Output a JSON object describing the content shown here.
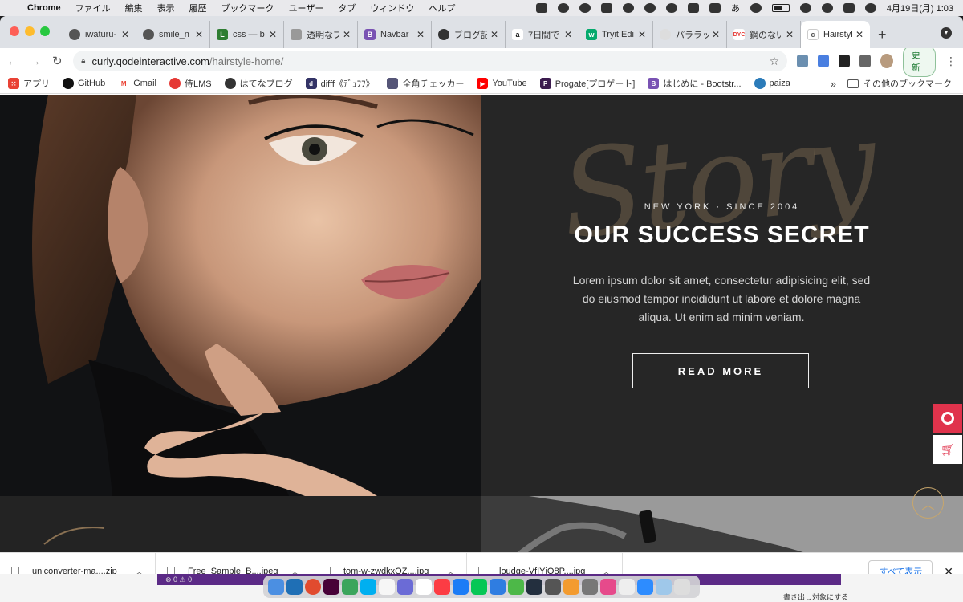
{
  "menubar": {
    "app": "Chrome",
    "items": [
      "ファイル",
      "編集",
      "表示",
      "履歴",
      "ブックマーク",
      "ユーザー",
      "タブ",
      "ウィンドウ",
      "ヘルプ"
    ],
    "datetime": "4月19日(月)  1:03",
    "input_method": "あ"
  },
  "tabs": [
    {
      "title": "iwaturu-",
      "color": "#555"
    },
    {
      "title": "smile_n",
      "color": "#555"
    },
    {
      "title": "css — b",
      "color": "#2e7d32"
    },
    {
      "title": "透明なブ",
      "color": "#999"
    },
    {
      "title": "Navbar",
      "color": "#7952b3"
    },
    {
      "title": "ブログ記",
      "color": "#333"
    },
    {
      "title": "7日間で",
      "color": "#222"
    },
    {
      "title": "Tryit Edi",
      "color": "#04aa6d"
    },
    {
      "title": "パララッ",
      "color": "#bbb"
    },
    {
      "title": "鋼のない",
      "color": "#e53935"
    }
  ],
  "active_tab": {
    "title": "Hairstyle"
  },
  "address": {
    "host": "curly.qodeinteractive.com",
    "path": "/hairstyle-home/"
  },
  "toolbar": {
    "update_label": "更新"
  },
  "bookmarks": [
    {
      "label": "アプリ",
      "color": "#e94235"
    },
    {
      "label": "GitHub",
      "color": "#111"
    },
    {
      "label": "Gmail",
      "color": "#ea4335"
    },
    {
      "label": "侍LMS",
      "color": "#e53935"
    },
    {
      "label": "はてなブログ",
      "color": "#333"
    },
    {
      "label": "difff《ﾃﾞｭﾌﾌ》",
      "color": "#336"
    },
    {
      "label": "全角チェッカー",
      "color": "#557"
    },
    {
      "label": "YouTube",
      "color": "#ff0000"
    },
    {
      "label": "Progate[プロゲート]",
      "color": "#3b1b4e"
    },
    {
      "label": "はじめに - Bootstr...",
      "color": "#7952b3"
    },
    {
      "label": "paiza",
      "color": "#2b7bb9"
    }
  ],
  "bookmarks_other": "その他のブックマーク",
  "hero": {
    "script_word": "Story",
    "eyebrow": "NEW YORK · SINCE 2004",
    "headline": "OUR SUCCESS SECRET",
    "body": "Lorem ipsum dolor sit amet, consectetur adipisicing elit, sed do eiusmod tempor incididunt ut labore et dolore magna aliqua. Ut enim ad minim veniam.",
    "button": "READ MORE"
  },
  "downloads": {
    "files": [
      "uniconverter-ma....zip",
      "Free_Sample_B....jpeg",
      "tom-w-zwdkxQZ....jpg",
      "loudge-VfIYjO8P....jpg"
    ],
    "show_all": "すべて表示"
  },
  "behind": {
    "status": "⊗ 0 ⚠ 0",
    "checkbox_label": "書き出し対象にする"
  },
  "colors": {
    "accent_gold": "#c8a66b",
    "side_red": "#e0334c"
  }
}
